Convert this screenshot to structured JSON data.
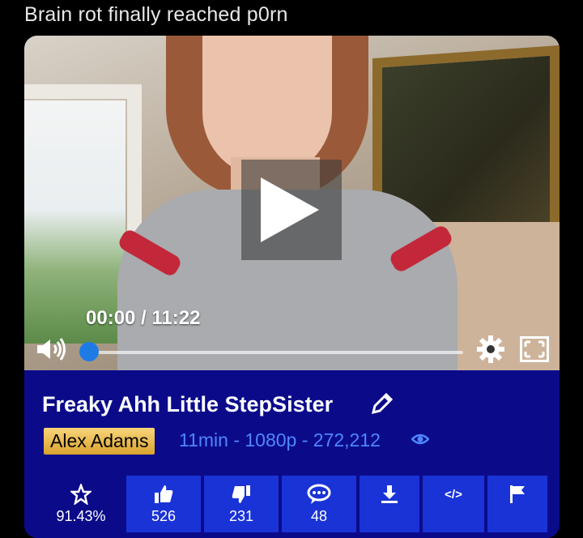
{
  "post": {
    "title": "Brain rot finally reached p0rn"
  },
  "player": {
    "current_time": "00:00",
    "duration": "11:22",
    "time_display": "00:00 / 11:22",
    "progress": 0.0,
    "icons": [
      "volume-icon",
      "gear-icon",
      "fullscreen-icon",
      "play-icon"
    ]
  },
  "video": {
    "title": "Freaky Ahh Little StepSister",
    "author": "Alex Adams",
    "meta": "11min - 1080p - 272,212"
  },
  "actions": [
    {
      "name": "rating",
      "icon": "star-icon",
      "label": "91.43%"
    },
    {
      "name": "like",
      "icon": "thumbs-up-icon",
      "label": "526"
    },
    {
      "name": "dislike",
      "icon": "thumbs-down-icon",
      "label": "231"
    },
    {
      "name": "comments",
      "icon": "comment-icon",
      "label": "48"
    },
    {
      "name": "download",
      "icon": "download-icon",
      "label": ""
    },
    {
      "name": "embed",
      "icon": "code-icon",
      "label": ""
    },
    {
      "name": "flag",
      "icon": "flag-icon",
      "label": ""
    }
  ],
  "colors": {
    "panel": "#0b0b8a",
    "button": "#1a33d6",
    "meta_text": "#4f86ff",
    "badge": "#f3c653",
    "seek_knob": "#1e7be6"
  }
}
